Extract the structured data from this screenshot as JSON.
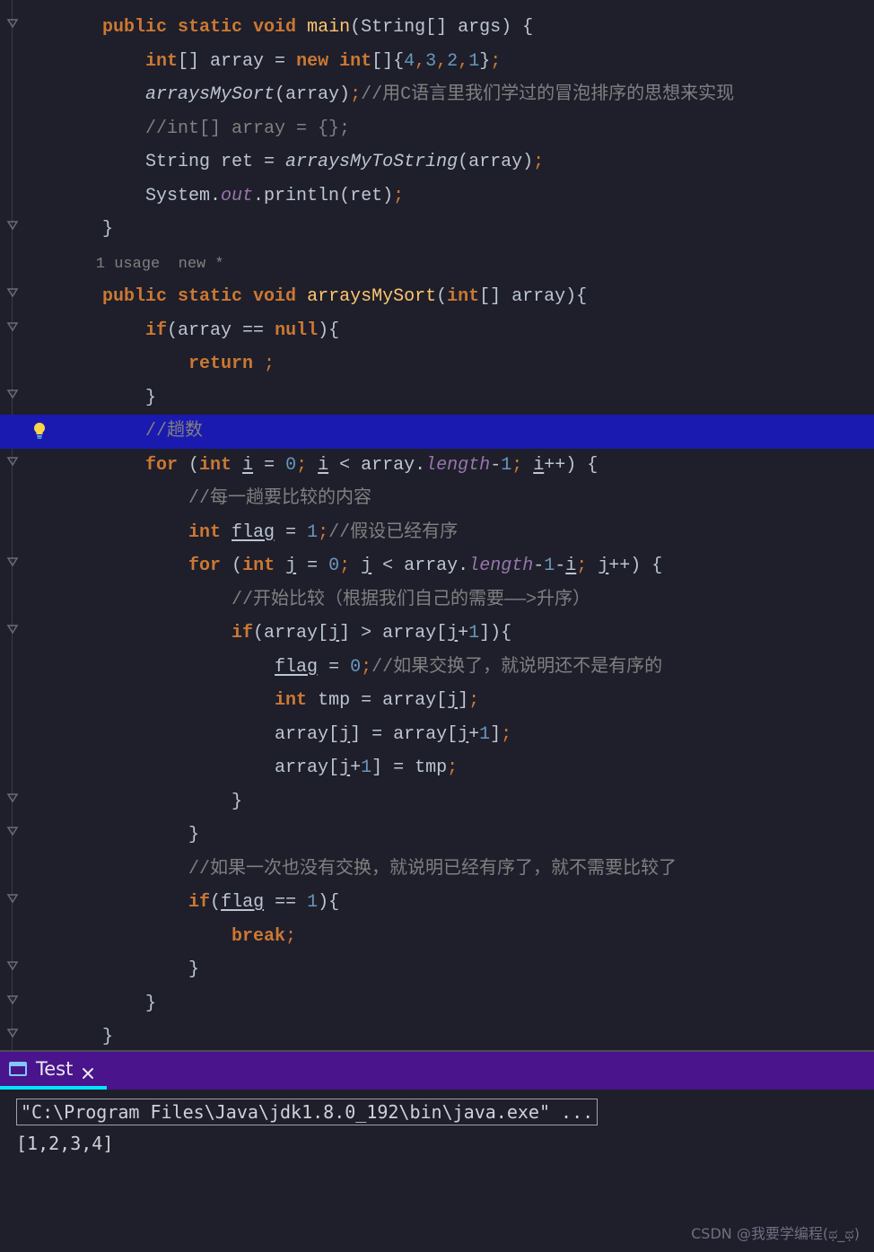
{
  "editor": {
    "meta_usage": "1 usage  new *",
    "highlight_line_index": 12,
    "lines": [
      {
        "indent": 1,
        "segs": [
          {
            "t": "public ",
            "c": "kw"
          },
          {
            "t": "static ",
            "c": "kw"
          },
          {
            "t": "void ",
            "c": "kw"
          },
          {
            "t": "main",
            "c": "mname"
          },
          {
            "t": "(String[] args) {",
            "c": ""
          }
        ]
      },
      {
        "indent": 2,
        "segs": [
          {
            "t": "int",
            "c": "kw"
          },
          {
            "t": "[] array = ",
            "c": ""
          },
          {
            "t": "new ",
            "c": "kw"
          },
          {
            "t": "int",
            "c": "kw"
          },
          {
            "t": "[]{",
            "c": ""
          },
          {
            "t": "4",
            "c": "num"
          },
          {
            "t": ",",
            "c": "kw2"
          },
          {
            "t": "3",
            "c": "num"
          },
          {
            "t": ",",
            "c": "kw2"
          },
          {
            "t": "2",
            "c": "num"
          },
          {
            "t": ",",
            "c": "kw2"
          },
          {
            "t": "1",
            "c": "num"
          },
          {
            "t": "}",
            "c": ""
          },
          {
            "t": ";",
            "c": "kw2"
          }
        ]
      },
      {
        "indent": 2,
        "segs": [
          {
            "t": "arraysMySort",
            "c": "mcall"
          },
          {
            "t": "(array)",
            "c": ""
          },
          {
            "t": ";",
            "c": "kw2"
          },
          {
            "t": "//用C语言里我们学过的冒泡排序的思想来实现",
            "c": "cmt"
          }
        ]
      },
      {
        "indent": 2,
        "segs": [
          {
            "t": "//int[] array = {};",
            "c": "cmt"
          }
        ]
      },
      {
        "indent": 2,
        "segs": [
          {
            "t": "String ret = ",
            "c": ""
          },
          {
            "t": "arraysMyToString",
            "c": "mcall"
          },
          {
            "t": "(array)",
            "c": ""
          },
          {
            "t": ";",
            "c": "kw2"
          }
        ]
      },
      {
        "indent": 2,
        "segs": [
          {
            "t": "System.",
            "c": ""
          },
          {
            "t": "out",
            "c": "fld"
          },
          {
            "t": ".println(ret)",
            "c": ""
          },
          {
            "t": ";",
            "c": "kw2"
          }
        ]
      },
      {
        "indent": 1,
        "segs": [
          {
            "t": "}",
            "c": ""
          }
        ]
      },
      {
        "indent": 1,
        "meta": true
      },
      {
        "indent": 1,
        "segs": [
          {
            "t": "public ",
            "c": "kw"
          },
          {
            "t": "static ",
            "c": "kw"
          },
          {
            "t": "void ",
            "c": "kw"
          },
          {
            "t": "arraysMySort",
            "c": "mname"
          },
          {
            "t": "(",
            "c": ""
          },
          {
            "t": "int",
            "c": "kw"
          },
          {
            "t": "[] array){",
            "c": ""
          }
        ]
      },
      {
        "indent": 2,
        "segs": [
          {
            "t": "if",
            "c": "kw"
          },
          {
            "t": "(array == ",
            "c": ""
          },
          {
            "t": "null",
            "c": "kw"
          },
          {
            "t": "){",
            "c": ""
          }
        ]
      },
      {
        "indent": 3,
        "segs": [
          {
            "t": "return ",
            "c": "kw"
          },
          {
            "t": ";",
            "c": "kw2"
          }
        ]
      },
      {
        "indent": 2,
        "segs": [
          {
            "t": "}",
            "c": ""
          }
        ]
      },
      {
        "indent": 2,
        "segs": [
          {
            "t": "//趟数",
            "c": "cmt"
          }
        ]
      },
      {
        "indent": 2,
        "segs": [
          {
            "t": "for ",
            "c": "kw"
          },
          {
            "t": "(",
            "c": ""
          },
          {
            "t": "int ",
            "c": "kw"
          },
          {
            "t": "i",
            "c": "uvar"
          },
          {
            "t": " = ",
            "c": ""
          },
          {
            "t": "0",
            "c": "num"
          },
          {
            "t": "; ",
            "c": "kw2"
          },
          {
            "t": "i",
            "c": "uvar"
          },
          {
            "t": " < array.",
            "c": ""
          },
          {
            "t": "length",
            "c": "fld"
          },
          {
            "t": "-",
            "c": ""
          },
          {
            "t": "1",
            "c": "num"
          },
          {
            "t": "; ",
            "c": "kw2"
          },
          {
            "t": "i",
            "c": "uvar"
          },
          {
            "t": "++) {",
            "c": ""
          }
        ]
      },
      {
        "indent": 3,
        "segs": [
          {
            "t": "//每一趟要比较的内容",
            "c": "cmt"
          }
        ]
      },
      {
        "indent": 3,
        "segs": [
          {
            "t": "int ",
            "c": "kw"
          },
          {
            "t": "flag",
            "c": "uvar"
          },
          {
            "t": " = ",
            "c": ""
          },
          {
            "t": "1",
            "c": "num"
          },
          {
            "t": ";",
            "c": "kw2"
          },
          {
            "t": "//假设已经有序",
            "c": "cmt"
          }
        ]
      },
      {
        "indent": 3,
        "segs": [
          {
            "t": "for ",
            "c": "kw"
          },
          {
            "t": "(",
            "c": ""
          },
          {
            "t": "int ",
            "c": "kw"
          },
          {
            "t": "j",
            "c": "uvar"
          },
          {
            "t": " = ",
            "c": ""
          },
          {
            "t": "0",
            "c": "num"
          },
          {
            "t": "; ",
            "c": "kw2"
          },
          {
            "t": "j",
            "c": "uvar"
          },
          {
            "t": " < array.",
            "c": ""
          },
          {
            "t": "length",
            "c": "fld"
          },
          {
            "t": "-",
            "c": ""
          },
          {
            "t": "1",
            "c": "num"
          },
          {
            "t": "-",
            "c": ""
          },
          {
            "t": "i",
            "c": "uvar"
          },
          {
            "t": "; ",
            "c": "kw2"
          },
          {
            "t": "j",
            "c": "uvar"
          },
          {
            "t": "++) {",
            "c": ""
          }
        ]
      },
      {
        "indent": 4,
        "segs": [
          {
            "t": "//开始比较（根据我们自己的需要——>升序）",
            "c": "cmt"
          }
        ]
      },
      {
        "indent": 4,
        "segs": [
          {
            "t": "if",
            "c": "kw"
          },
          {
            "t": "(array[",
            "c": ""
          },
          {
            "t": "j",
            "c": "uvar"
          },
          {
            "t": "] > array[",
            "c": ""
          },
          {
            "t": "j",
            "c": "uvar"
          },
          {
            "t": "+",
            "c": ""
          },
          {
            "t": "1",
            "c": "num"
          },
          {
            "t": "]){",
            "c": ""
          }
        ]
      },
      {
        "indent": 5,
        "segs": [
          {
            "t": "flag",
            "c": "uvar"
          },
          {
            "t": " = ",
            "c": ""
          },
          {
            "t": "0",
            "c": "num"
          },
          {
            "t": ";",
            "c": "kw2"
          },
          {
            "t": "//如果交换了，就说明还不是有序的",
            "c": "cmt"
          }
        ]
      },
      {
        "indent": 5,
        "segs": [
          {
            "t": "int ",
            "c": "kw"
          },
          {
            "t": "tmp = array[",
            "c": ""
          },
          {
            "t": "j",
            "c": "uvar"
          },
          {
            "t": "]",
            "c": ""
          },
          {
            "t": ";",
            "c": "kw2"
          }
        ]
      },
      {
        "indent": 5,
        "segs": [
          {
            "t": "array[",
            "c": ""
          },
          {
            "t": "j",
            "c": "uvar"
          },
          {
            "t": "] = array[",
            "c": ""
          },
          {
            "t": "j",
            "c": "uvar"
          },
          {
            "t": "+",
            "c": ""
          },
          {
            "t": "1",
            "c": "num"
          },
          {
            "t": "]",
            "c": ""
          },
          {
            "t": ";",
            "c": "kw2"
          }
        ]
      },
      {
        "indent": 5,
        "segs": [
          {
            "t": "array[",
            "c": ""
          },
          {
            "t": "j",
            "c": "uvar"
          },
          {
            "t": "+",
            "c": ""
          },
          {
            "t": "1",
            "c": "num"
          },
          {
            "t": "] = tmp",
            "c": ""
          },
          {
            "t": ";",
            "c": "kw2"
          }
        ]
      },
      {
        "indent": 4,
        "segs": [
          {
            "t": "}",
            "c": ""
          }
        ]
      },
      {
        "indent": 3,
        "segs": [
          {
            "t": "}",
            "c": ""
          }
        ]
      },
      {
        "indent": 3,
        "segs": [
          {
            "t": "//如果一次也没有交换，就说明已经有序了，就不需要比较了",
            "c": "cmt"
          }
        ]
      },
      {
        "indent": 3,
        "segs": [
          {
            "t": "if",
            "c": "kw"
          },
          {
            "t": "(",
            "c": ""
          },
          {
            "t": "flag",
            "c": "uvar"
          },
          {
            "t": " == ",
            "c": ""
          },
          {
            "t": "1",
            "c": "num"
          },
          {
            "t": "){",
            "c": ""
          }
        ]
      },
      {
        "indent": 4,
        "segs": [
          {
            "t": "break",
            "c": "kw"
          },
          {
            "t": ";",
            "c": "kw2"
          }
        ]
      },
      {
        "indent": 3,
        "segs": [
          {
            "t": "}",
            "c": ""
          }
        ]
      },
      {
        "indent": 2,
        "segs": [
          {
            "t": "}",
            "c": ""
          }
        ]
      },
      {
        "indent": 1,
        "segs": [
          {
            "t": "}",
            "c": ""
          }
        ]
      }
    ],
    "fold_markers": [
      0,
      6,
      8,
      9,
      11,
      13,
      16,
      18,
      23,
      24,
      26,
      28,
      29,
      30
    ]
  },
  "tabbar": {
    "tab_label": "Test"
  },
  "console": {
    "cmd": "\"C:\\Program Files\\Java\\jdk1.8.0_192\\bin\\java.exe\" ...",
    "output": "[1,2,3,4]"
  },
  "watermark": "CSDN @我要学编程(ಥ_ಥ)"
}
